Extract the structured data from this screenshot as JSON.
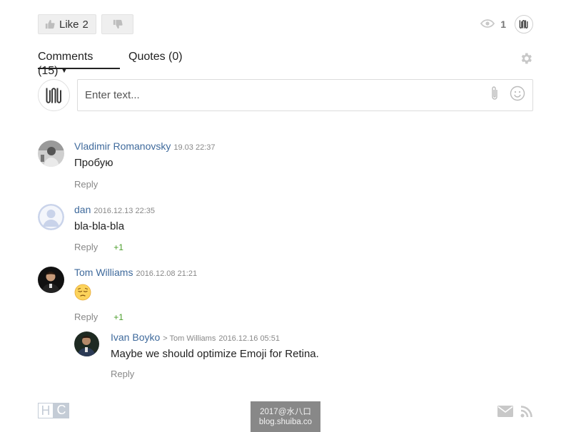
{
  "toolbar": {
    "like_label": "Like",
    "like_count": "2",
    "views_count": "1"
  },
  "tabs": {
    "comments": "Comments (15)",
    "quotes": "Quotes (0)"
  },
  "compose": {
    "placeholder": "Enter text..."
  },
  "comments": [
    {
      "author": "Vladimir Romanovsky",
      "date": "19.03 22:37",
      "text": "Пробую",
      "reply_label": "Reply",
      "plus": ""
    },
    {
      "author": "dan",
      "date": "2016.12.13 22:35",
      "text": "bla-bla-bla",
      "reply_label": "Reply",
      "plus": "+1"
    },
    {
      "author": "Tom Williams",
      "date": "2016.12.08 21:21",
      "text": "😔",
      "reply_label": "Reply",
      "plus": "+1"
    },
    {
      "author": "Ivan Boyko",
      "reply_to": "> Tom Williams",
      "date": "2016.12.16 05:51",
      "text": "Maybe we should optimize Emoji for Retina.",
      "reply_label": "Reply",
      "plus": ""
    }
  ],
  "footer": {
    "logo_h": "H",
    "logo_c": "C",
    "watermark_line1": "2017@水八口",
    "watermark_line2": "blog.shuiba.co"
  },
  "colors": {
    "author": "#3f6a9c",
    "plus": "#4a9d2a",
    "icon_gray": "#c8c8c8"
  }
}
